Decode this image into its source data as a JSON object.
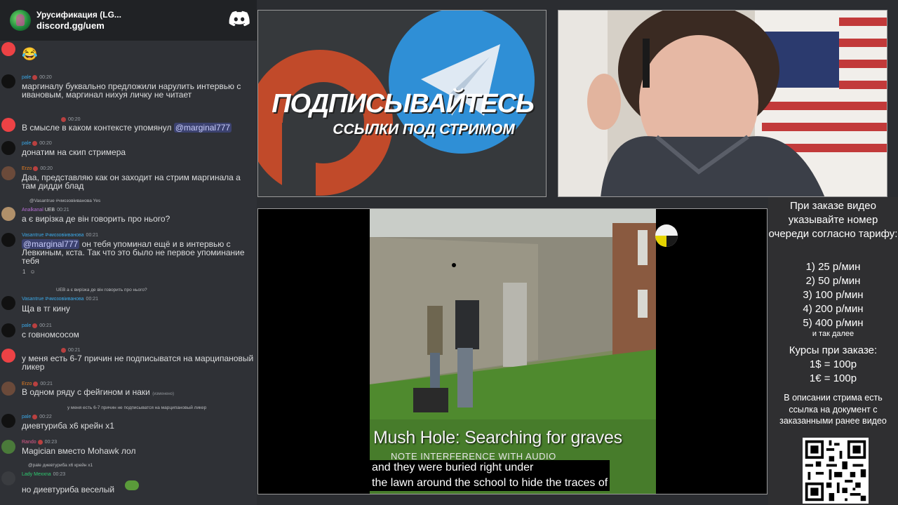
{
  "server": {
    "title": "Урусификация (LG...",
    "invite": "discord.gg/uem"
  },
  "messages": [
    {
      "avatar": "red",
      "emoji": "😂"
    },
    {
      "author": "pale",
      "time": "00:20",
      "text": "маргиналу буквально предложили нарулить интервью с ивановым, маргинал нихуя личку не читает"
    },
    {
      "time": "00:20",
      "text": "В смысле в каком контексте упомянул",
      "mention": "@marginal777"
    },
    {
      "author": "pale",
      "time": "00:20",
      "text": "донатим на скип стримера"
    },
    {
      "author": "Erzo",
      "time": "00:20",
      "text": "Даа, представляю как он заходит на стрим маргинала а там дидди блад"
    },
    {
      "reply": "@Vasantrue #чмозовіиванова Yes",
      "author": "Analkanal",
      "badge": "UEB",
      "time": "00:21",
      "text": "а є вирізка де він говорить про нього?"
    },
    {
      "author": "Vasantrue #чмозовіиванова",
      "time": "00:21",
      "mention": "@marginal777",
      "text": "он тебя упоминал ещё и в интервью с Левкиным, кста. Так что это было не первое упоминание тебя",
      "reactions": [
        "1",
        "☺"
      ]
    },
    {
      "reply": "UEB а є вирізка де він говорить про нього?",
      "author": "Vasantrue #чмозовіиванова",
      "time": "00:21",
      "text": "Ща в тг кину"
    },
    {
      "author": "pale",
      "time": "00:21",
      "text": "с говномсосом"
    },
    {
      "time": "00:21",
      "text": "у меня есть 6-7 причин не подписыватся на марципановый ликер"
    },
    {
      "author": "Erzo",
      "time": "00:21",
      "text": "В одном ряду с фейгином и наки",
      "edited": "(изменено)"
    },
    {
      "reply": "у меня есть 6-7 причин не подписыватся на марципановый ликер",
      "author": "pale",
      "time": "00:22",
      "text": "диевтуриба х6 крейн х1"
    },
    {
      "author": "Rando",
      "time": "00:23",
      "text": "Magician вместо Mohawk лол"
    },
    {
      "reply": "@pale диевтуриба х6 крейн х1",
      "author": "Lady Mexxna",
      "time": "00:23",
      "text": "но диевтуриба веселый"
    }
  ],
  "promo": {
    "title": "ПОДПИСЫВАЙТЕСЬ",
    "subtitle": "ССЫЛКИ ПОД СТРИМОМ"
  },
  "video": {
    "caption_title": "Mush Hole: Searching for graves",
    "caption_note": "NOTE INTERFERENCE WITH AUDIO",
    "subtitle_line1": "and they were buried right under",
    "subtitle_line2": "the lawn around the school to hide the traces of"
  },
  "info": {
    "intro": "При заказе видео указывайте номер очереди согласно тарифу:",
    "prices": [
      "1) 25 р/мин",
      "2) 50 р/мин",
      "3) 100 р/мин",
      "4) 200 р/мин",
      "5) 400 р/мин"
    ],
    "more": "и так далее",
    "rates_title": "Курсы при заказе:",
    "rates": [
      "1$ = 100р",
      "1€ = 100р"
    ],
    "description": "В описании стрима есть ссылка на документ с заказанными ранее видео"
  },
  "colors": {
    "discord_blurple": "#5865f2",
    "chat_bg": "#2f3136",
    "link_blue": "#3aa7e6",
    "mention_bg": "#3c4270"
  }
}
